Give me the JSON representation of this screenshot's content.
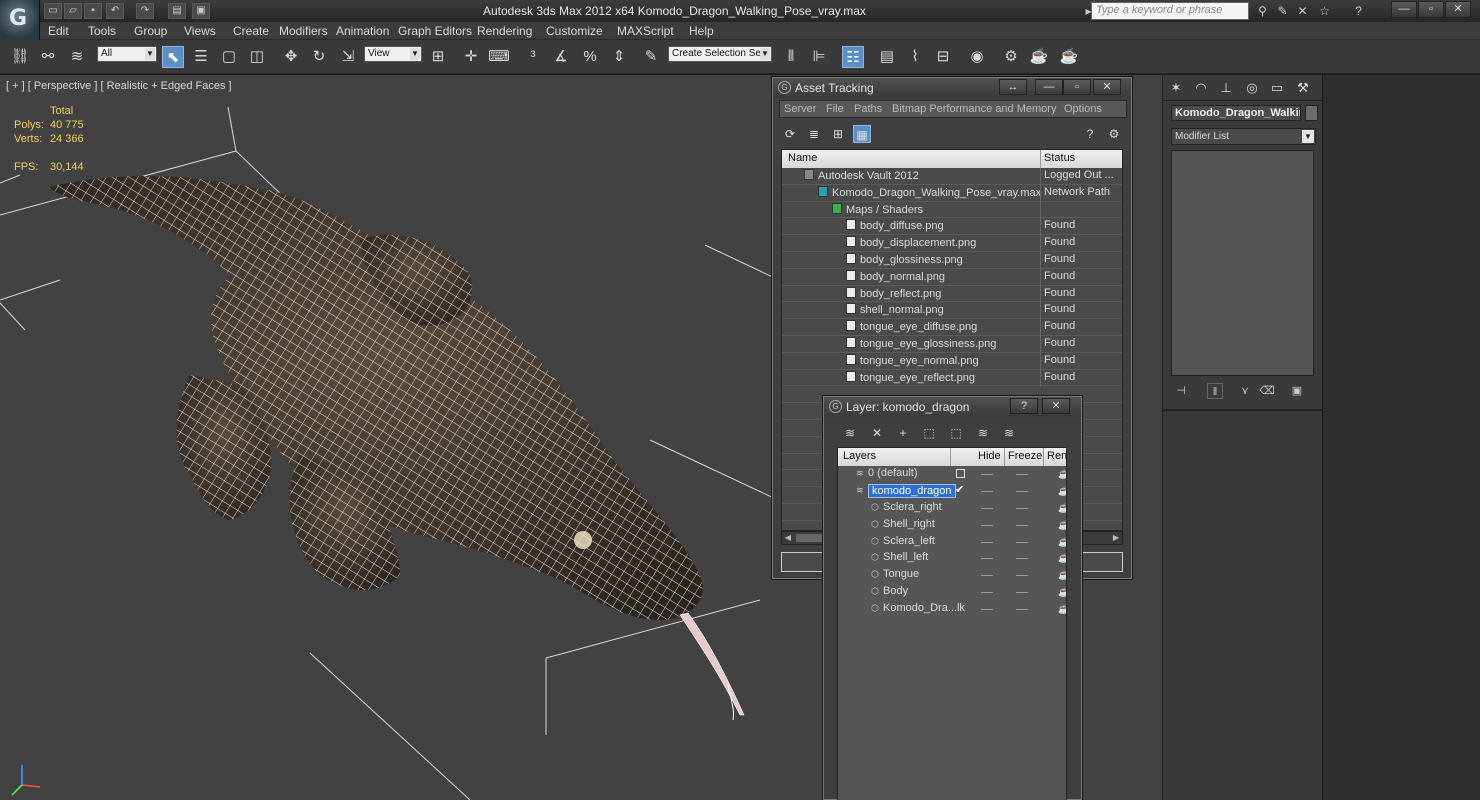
{
  "titlebar": {
    "title": "Autodesk 3ds Max  2012 x64      Komodo_Dragon_Walking_Pose_vray.max",
    "search_placeholder": "Type a keyword or phrase"
  },
  "menu": [
    "Edit",
    "Tools",
    "Group",
    "Views",
    "Create",
    "Modifiers",
    "Animation",
    "Graph Editors",
    "Rendering",
    "Customize",
    "MAXScript",
    "Help"
  ],
  "toolbar": {
    "selection_filter": "All",
    "reference_coord": "View",
    "named_selection_placeholder": "Create Selection Se"
  },
  "viewport": {
    "label": "[ + ] [ Perspective ] [ Realistic + Edged Faces ]",
    "stats": {
      "total_label": "Total",
      "polys_label": "Polys:",
      "polys_value": "40 775",
      "verts_label": "Verts:",
      "verts_value": "24 366",
      "fps_label": "FPS:",
      "fps_value": "30,144"
    }
  },
  "command_panel": {
    "object_name": "Komodo_Dragon_Walkin",
    "modifier_list": "Modifier List"
  },
  "asset_tracking": {
    "title": "Asset Tracking",
    "menu": [
      "Server",
      "File",
      "Paths",
      "Bitmap Performance and Memory",
      "Options"
    ],
    "columns": {
      "name": "Name",
      "status": "Status"
    },
    "rows": [
      {
        "name": "Autodesk Vault 2012",
        "status": "Logged Out ..."
      },
      {
        "name": "Komodo_Dragon_Walking_Pose_vray.max",
        "status": "Network Path"
      },
      {
        "name": "Maps / Shaders",
        "status": ""
      },
      {
        "name": "body_diffuse.png",
        "status": "Found"
      },
      {
        "name": "body_displacement.png",
        "status": "Found"
      },
      {
        "name": "body_glossiness.png",
        "status": "Found"
      },
      {
        "name": "body_normal.png",
        "status": "Found"
      },
      {
        "name": "body_reflect.png",
        "status": "Found"
      },
      {
        "name": "shell_normal.png",
        "status": "Found"
      },
      {
        "name": "tongue_eye_diffuse.png",
        "status": "Found"
      },
      {
        "name": "tongue_eye_glossiness.png",
        "status": "Found"
      },
      {
        "name": "tongue_eye_normal.png",
        "status": "Found"
      },
      {
        "name": "tongue_eye_reflect.png",
        "status": "Found"
      }
    ]
  },
  "layer_window": {
    "title": "Layer: komodo_dragon",
    "columns": {
      "layers": "Layers",
      "hide": "Hide",
      "freeze": "Freeze",
      "render": "Ren"
    },
    "rows": [
      {
        "name": "0 (default)"
      },
      {
        "name": "komodo_dragon"
      },
      {
        "name": "Sclera_right"
      },
      {
        "name": "Shell_right"
      },
      {
        "name": "Sclera_left"
      },
      {
        "name": "Shell_left"
      },
      {
        "name": "Tongue"
      },
      {
        "name": "Body"
      },
      {
        "name": "Komodo_Dra...lk"
      }
    ]
  }
}
